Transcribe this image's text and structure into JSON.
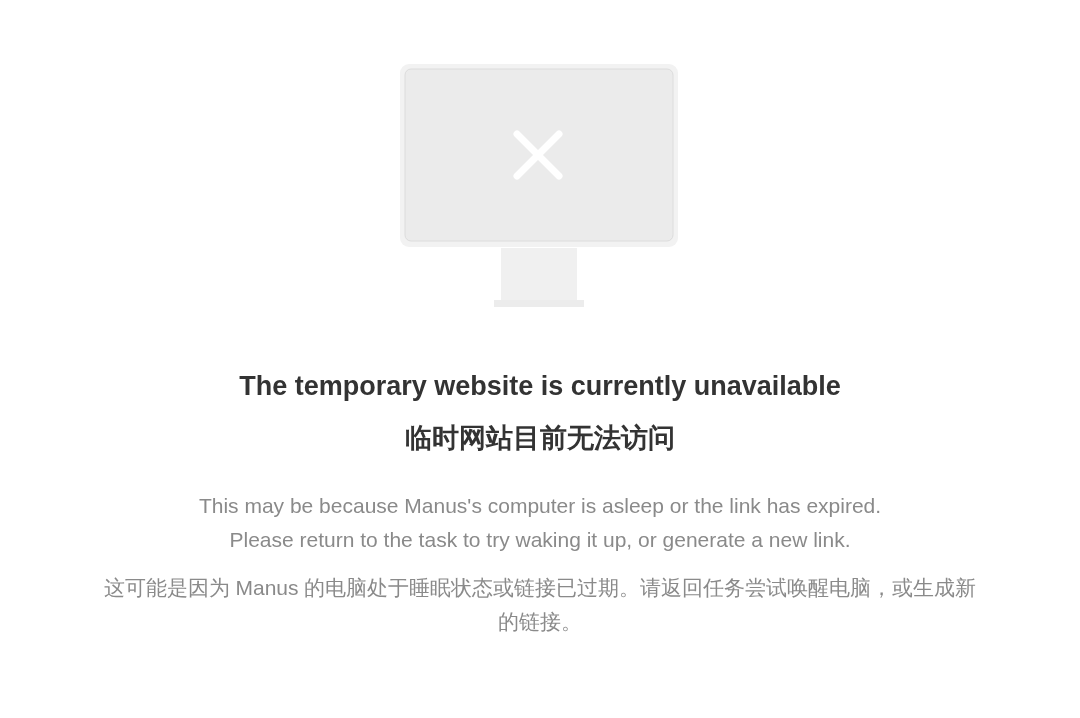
{
  "error_page": {
    "title": "The temporary website is currently unavailable",
    "title_zh": "临时网站目前无法访问",
    "message_lines": [
      "This may be because Manus's computer is asleep or the link has expired.",
      "Please return to the task to try waking it up, or generate a new link."
    ],
    "message_zh": "这可能是因为 Manus 的电脑处于睡眠状态或链接已过期。请返回任务尝试唤醒电脑，或生成新的链接。"
  }
}
